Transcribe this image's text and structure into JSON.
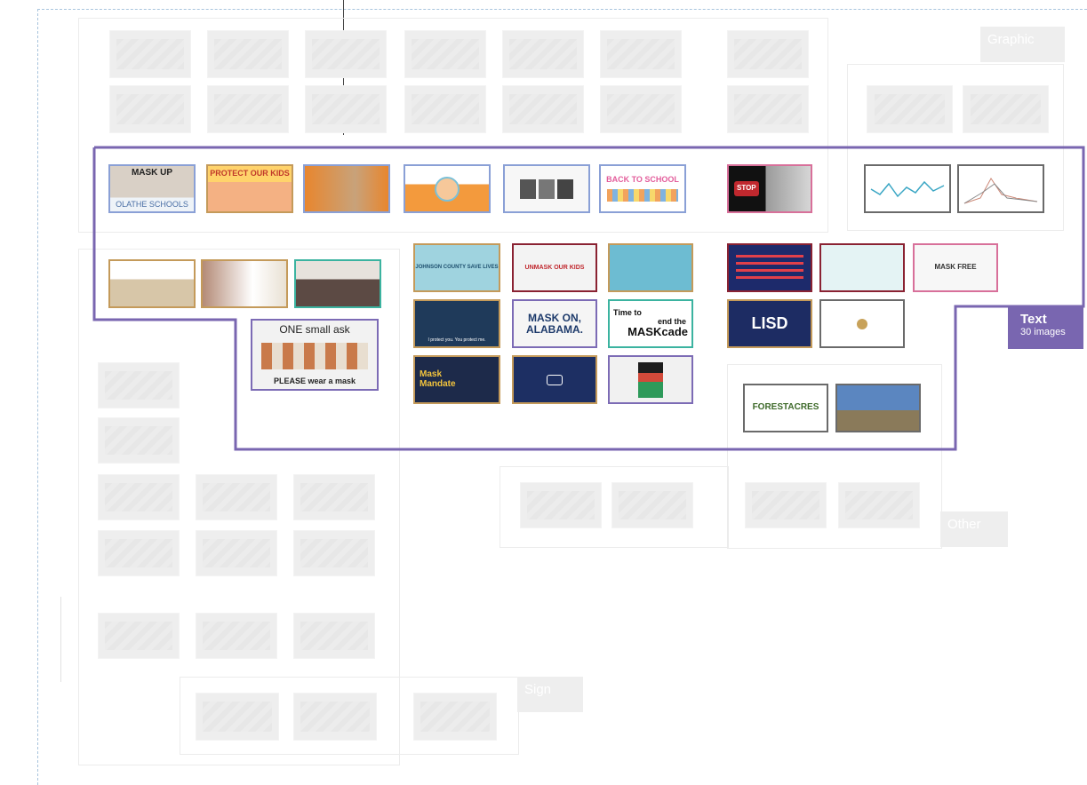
{
  "groups": {
    "text": {
      "title": "Text",
      "subtitle": "30 images"
    },
    "graphic": {
      "title": "Graphic"
    },
    "other": {
      "title": "Other"
    },
    "sign": {
      "title": "Sign"
    }
  },
  "thumbnails": {
    "olathe": {
      "line1": "MASK UP",
      "line2": "OLATHE SCHOOLS"
    },
    "protect": {
      "text": "PROTECT OUR KIDS"
    },
    "back_to_school": {
      "text": "BACK TO SCHOOL"
    },
    "stop": {
      "text": "STOP"
    },
    "mask_on_alabama": {
      "line1": "MASK ON,",
      "line2": "ALABAMA."
    },
    "maskcade": {
      "line1": "Time to",
      "line2": "end the",
      "line3": "MASKcade"
    },
    "mask_mandate": {
      "line1": "Mask",
      "line2": "Mandate"
    },
    "lisd": {
      "text": "LISD"
    },
    "forestacres": {
      "text": "FORESTACRES"
    },
    "one_small_ask": {
      "line1": "ONE small ask",
      "line2": "PLEASE wear a mask"
    },
    "mask_free": {
      "text": "MASK FREE"
    },
    "johnson_county": {
      "text": "JOHNSON COUNTY SAVE LIVES"
    },
    "unmask_kids": {
      "text": "UNMASK OUR KIDS"
    },
    "i_protect_you": {
      "text": "I protect you.   You protect me."
    }
  },
  "colors": {
    "frame": "#7966b0",
    "blue": "#8aa0d6",
    "gold": "#c49a5a",
    "purple": "#7c6bb5",
    "maroon": "#8a2232",
    "pink": "#d8709a",
    "gray": "#6a6a6a",
    "teal": "#3bb3a0"
  }
}
